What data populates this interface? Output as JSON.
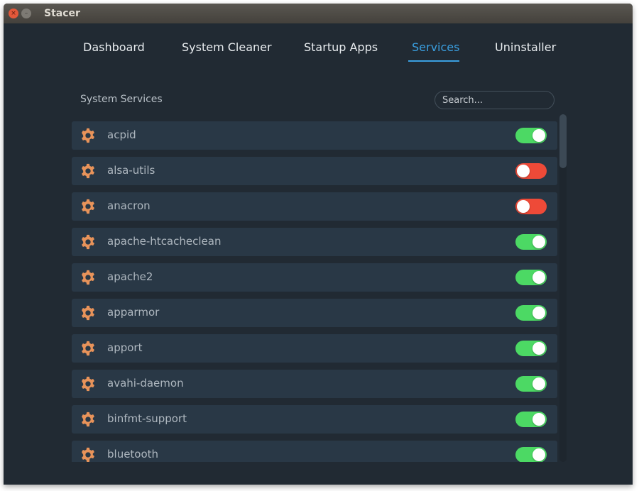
{
  "window": {
    "title": "Stacer",
    "buttons": [
      {
        "name": "close",
        "glyph": "×"
      },
      {
        "name": "minimize",
        "glyph": "–"
      }
    ]
  },
  "nav": {
    "tabs": [
      {
        "label": "Dashboard",
        "active": false
      },
      {
        "label": "System Cleaner",
        "active": false
      },
      {
        "label": "Startup Apps",
        "active": false
      },
      {
        "label": "Services",
        "active": true
      },
      {
        "label": "Uninstaller",
        "active": false
      }
    ],
    "accent_color": "#3a9fe0"
  },
  "services_panel": {
    "title": "System Services",
    "search": {
      "placeholder": "Search...",
      "value": ""
    },
    "icon": "gear-icon",
    "colors": {
      "on": "#4cd964",
      "off": "#ee4a38",
      "icon": "#e8935a"
    },
    "items": [
      {
        "name": "acpid",
        "enabled": true
      },
      {
        "name": "alsa-utils",
        "enabled": false
      },
      {
        "name": "anacron",
        "enabled": false
      },
      {
        "name": "apache-htcacheclean",
        "enabled": true
      },
      {
        "name": "apache2",
        "enabled": true
      },
      {
        "name": "apparmor",
        "enabled": true
      },
      {
        "name": "apport",
        "enabled": true
      },
      {
        "name": "avahi-daemon",
        "enabled": true
      },
      {
        "name": "binfmt-support",
        "enabled": true
      },
      {
        "name": "bluetooth",
        "enabled": true
      }
    ]
  }
}
